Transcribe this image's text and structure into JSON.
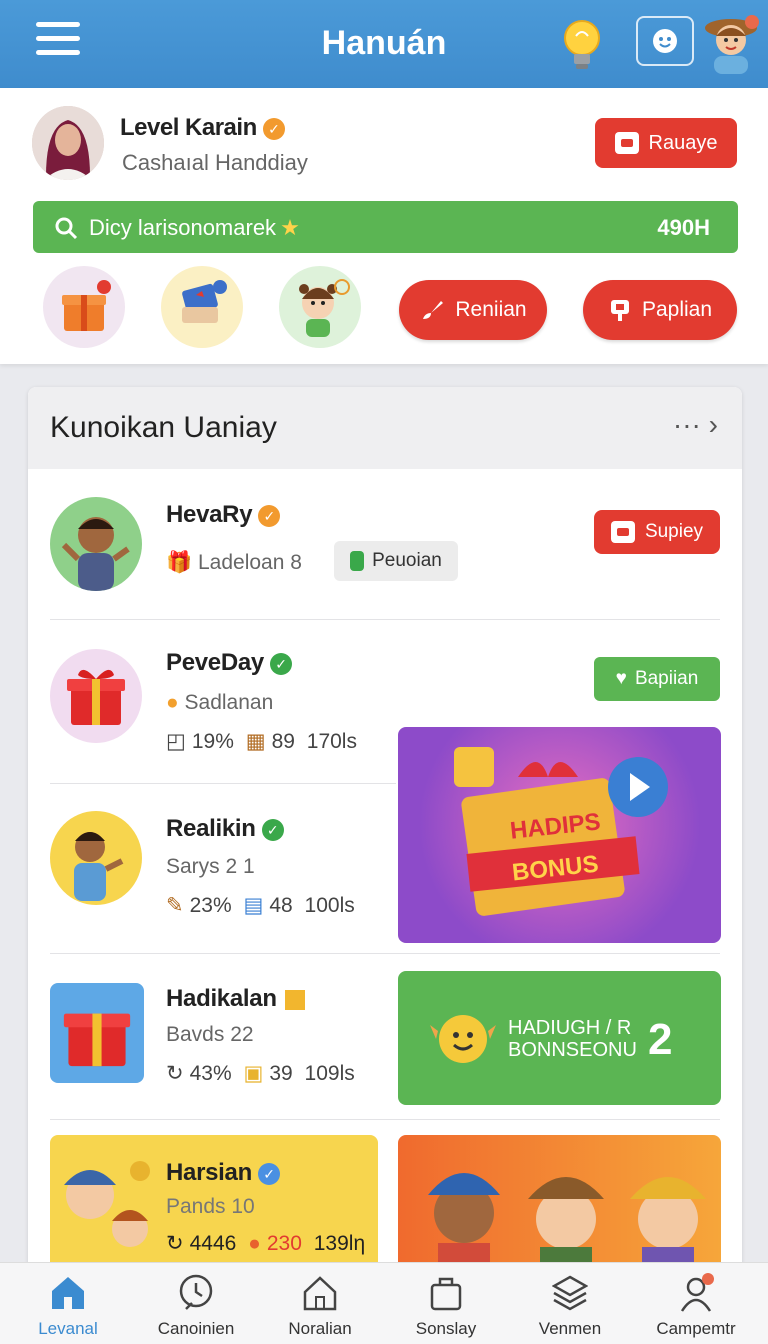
{
  "appbar": {
    "title": "Hanuán",
    "menu_icon": "hamburger-icon",
    "bulb_icon": "lightbulb-icon",
    "face_icon": "face-icon",
    "avatar_icon": "user-avatar-icon"
  },
  "profile": {
    "name": "Level Karain",
    "subtitle": "Cashaıal Handdiay",
    "action_label": "Rauaye",
    "search_text": "Dicy larisonomarek",
    "search_value": "490H",
    "quick_actions": [
      {
        "label": "Reniian"
      },
      {
        "label": "Paplian"
      }
    ]
  },
  "section": {
    "title": "Kunoikan Uaniay",
    "more": "···",
    "rows": [
      {
        "name": "HevaRy",
        "sub": "Ladeloan 8",
        "tag": "Peuoian",
        "action": "Supiey"
      },
      {
        "name": "PeveDay",
        "sub": "Sadlanan",
        "stat1": "19%",
        "stat2": "89",
        "stat3": "170ls",
        "action": "Bapiian"
      },
      {
        "name": "Realikin",
        "sub": "Sarys 2 1",
        "stat1": "23%",
        "stat2": "48",
        "stat3": "100ls"
      },
      {
        "name": "Hadikalan",
        "sub": "Bavds 22",
        "stat1": "43%",
        "stat2": "39",
        "stat3": "109ls"
      },
      {
        "name": "Harsian",
        "sub": "Pands 10",
        "stat1": "4446",
        "stat2": "230",
        "stat3": "139lη"
      }
    ],
    "promo1": {
      "line1": "HADIPS",
      "line2": "BONUS"
    },
    "promo2": {
      "line1": "HADIUGH / R",
      "line2": "BONNSEONU",
      "num": "2"
    }
  },
  "nav": [
    {
      "label": "Levanal",
      "icon": "home-icon"
    },
    {
      "label": "Canoinien",
      "icon": "clock-icon"
    },
    {
      "label": "Noralian",
      "icon": "house-outline-icon"
    },
    {
      "label": "Sonslay",
      "icon": "bag-icon"
    },
    {
      "label": "Venmen",
      "icon": "layers-icon"
    },
    {
      "label": "Campemtr",
      "icon": "profile-icon"
    }
  ],
  "colors": {
    "appbar": "#4b9ad8",
    "accent_red": "#e23b30",
    "accent_green": "#5bb553",
    "nav_active": "#3b8bd0"
  }
}
